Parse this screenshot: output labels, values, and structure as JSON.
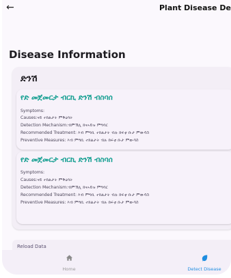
{
  "appbar": {
    "title": "Plant Disease Detail",
    "back_icon": "arrow-left-icon"
  },
  "section_title": "Disease Information",
  "category": {
    "title": "ድንሽ",
    "diseases": [
      {
        "name": "የድ መጀመርታ ብርኪ ድንሽ ብስባሰ",
        "symptoms": "Symptoms:",
        "causes": "Causes:ናይ ተክልታት ምቅዕባት",
        "detection": "Detection Mechanism:ብምኽሊ ክናኣይዝ ምግባር",
        "treatment": "Recommended Treatment: እብ ምግቢ ተክልታት ብሉ ክፍቲ ቡታ ምውሳስ",
        "prevention": "Preventive Measures: እብ ምግቢ ተክልታት ብሉ ክፍቲ ቡታ ምውሳስ"
      },
      {
        "name": "የድ መጀመርታ ብርኪ ድንሽ ብስባሰ",
        "symptoms": "Symptoms:",
        "causes": "Causes:ናይ ተክልታት ምቅዕባት",
        "detection": "Detection Mechanism:ብምኽሊ ክናኣይዝ ምግባር",
        "treatment": "Recommended Treatment: እብ ምግቢ ተክልታት ብሉ ክፍቲ ቡታ ምውሳስ",
        "prevention": "Preventive Measures: እብ ምግቢ ተክልታት ብሉ ክፍቲ ቡታ ምውሳስ"
      }
    ]
  },
  "reload_label": "Reload Data",
  "bottom_nav": {
    "home_label": "Home",
    "home_icon": "home-icon",
    "detect_label": "Detect Disease",
    "detect_icon": "leaf-icon"
  },
  "colors": {
    "accent": "#109d8f",
    "nav_active": "#1f8de0",
    "surface": "#f3eef6"
  }
}
